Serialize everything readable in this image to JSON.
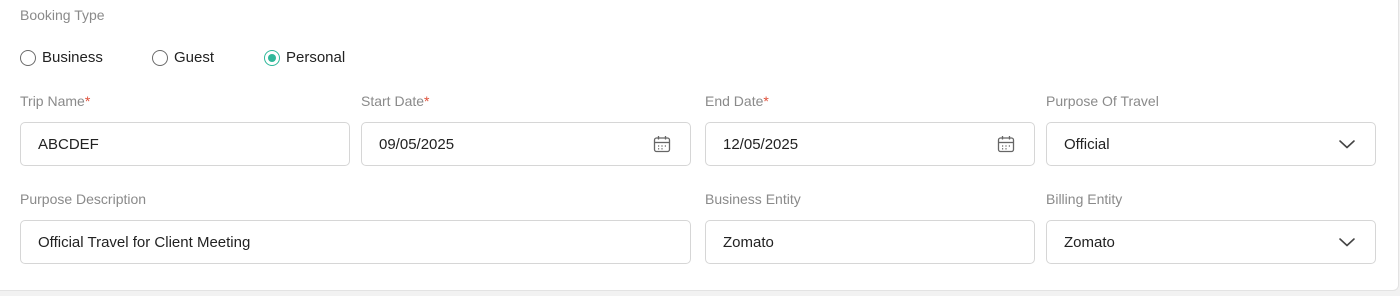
{
  "booking_type": {
    "label": "Booking Type",
    "options": [
      {
        "label": "Business",
        "checked": false
      },
      {
        "label": "Guest",
        "checked": false
      },
      {
        "label": "Personal",
        "checked": true
      }
    ]
  },
  "trip_name": {
    "label": "Trip Name",
    "required": "*",
    "value": "ABCDEF"
  },
  "start_date": {
    "label": "Start Date",
    "required": "*",
    "value": "09/05/2025",
    "icon": "calendar-icon"
  },
  "end_date": {
    "label": "End Date",
    "required": "*",
    "value": "12/05/2025",
    "icon": "calendar-icon"
  },
  "purpose_of_travel": {
    "label": "Purpose Of Travel",
    "value": "Official",
    "icon": "chevron-down-icon"
  },
  "purpose_description": {
    "label": "Purpose Description",
    "value": "Official Travel for Client Meeting"
  },
  "business_entity": {
    "label": "Business Entity",
    "value": "Zomato"
  },
  "billing_entity": {
    "label": "Billing Entity",
    "value": "Zomato",
    "icon": "chevron-down-icon"
  },
  "colors": {
    "accent": "#2fb89a",
    "required": "#e0503a",
    "label": "#8a8a8a",
    "border": "#d6d6d6"
  }
}
